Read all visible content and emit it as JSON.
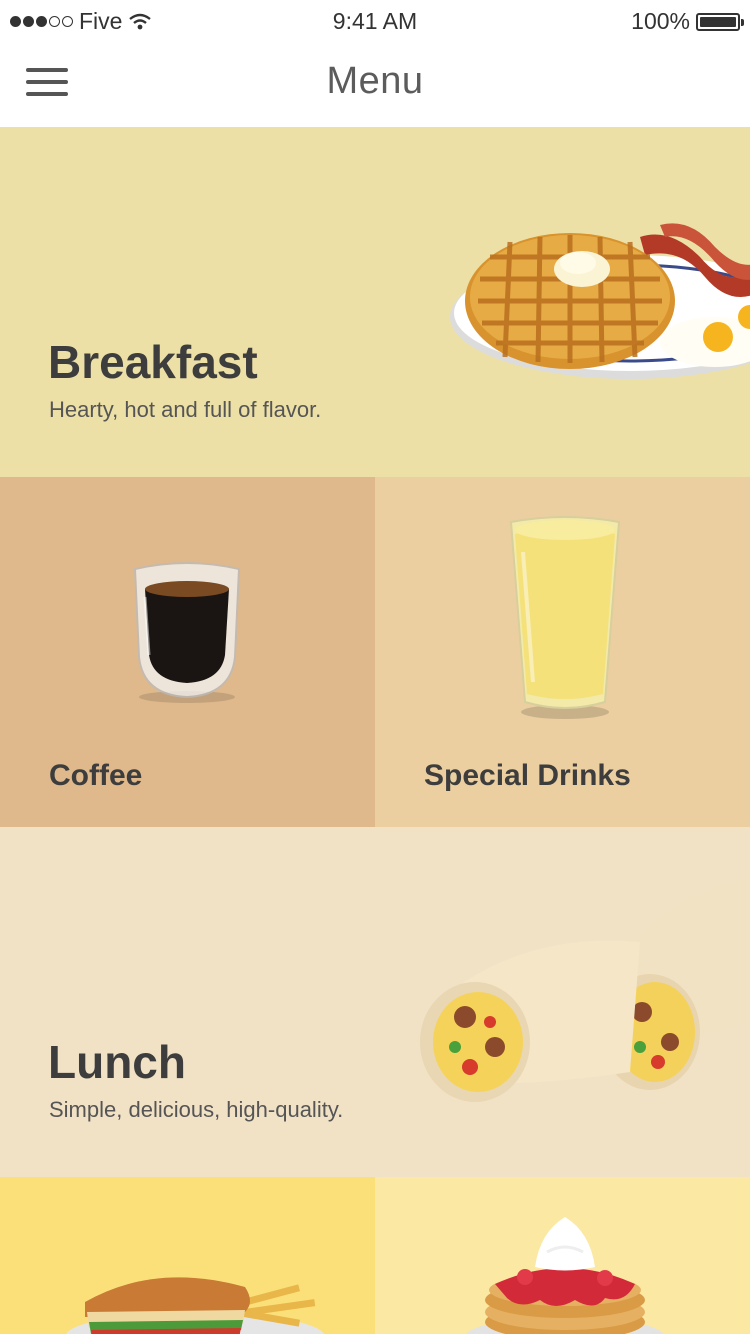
{
  "status_bar": {
    "carrier": "Five",
    "time": "9:41 AM",
    "battery": "100%"
  },
  "nav": {
    "title": "Menu",
    "menu_icon": "hamburger-menu-icon"
  },
  "tiles": {
    "breakfast": {
      "title": "Breakfast",
      "subtitle": "Hearty, hot and full of flavor.",
      "image": "waffle-plate-image"
    },
    "coffee": {
      "title": "Coffee",
      "image": "espresso-glass-image"
    },
    "special_drinks": {
      "title": "Special Drinks",
      "image": "smoothie-glass-image"
    },
    "lunch": {
      "title": "Lunch",
      "subtitle": "Simple, delicious, high-quality.",
      "image": "burrito-image"
    },
    "sandwich": {
      "image": "sandwich-plate-image"
    },
    "pancakes": {
      "image": "pancake-stack-image"
    }
  },
  "colors": {
    "breakfast_bg": "#ece0a6",
    "coffee_bg": "#dfb98c",
    "drinks_bg": "#eccfa0",
    "lunch_bg": "#f1e2c6",
    "sandwich_bg": "#fbe07a",
    "pancake_bg": "#fbe8a2"
  }
}
